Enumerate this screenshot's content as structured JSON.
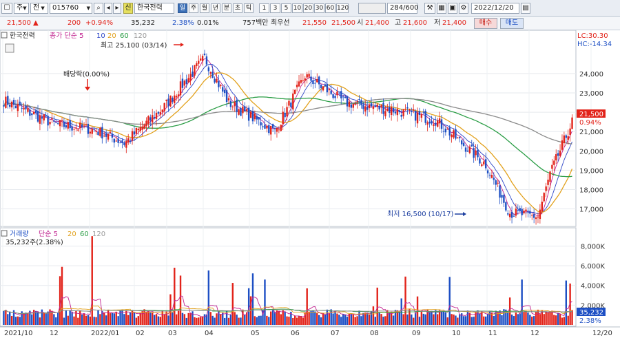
{
  "toolbar": {
    "market_select": "주",
    "type_select": "전",
    "code": "015760",
    "new_badge": "신",
    "stock_name": "한국전력",
    "periods": [
      "일",
      "주",
      "월",
      "년",
      "분",
      "초",
      "틱"
    ],
    "active_period": "일",
    "intervals": [
      "1",
      "3",
      "5",
      "10",
      "20",
      "30",
      "60",
      "120"
    ],
    "count": "284/600",
    "date": "2022/12/20"
  },
  "quote": {
    "price": "21,500",
    "arrow": "▲",
    "change": "200",
    "change_pct": "+0.94%",
    "volume": "35,232",
    "turnover_pct": "2.38%",
    "ratio": "0.01%",
    "amount": "757백만",
    "best_label": "최우선",
    "ask": "21,550",
    "bid": "21,500",
    "open_label": "시",
    "open": "21,400",
    "high_label": "고",
    "high": "21,600",
    "low_label": "저",
    "low": "21,400",
    "buy_btn": "매수",
    "sell_btn": "매도"
  },
  "price_panel": {
    "legend_name": "한국전력",
    "legend_ma_label": "종가 단순 5",
    "legend_periods": [
      "10",
      "20",
      "60",
      "120"
    ],
    "lc": "LC:30.30",
    "hc": "HC:-14.34",
    "annotation_high": "최고 25,100 (03/14)",
    "annotation_low": "최저 16,500 (10/17)",
    "annotation_div": "배당락(0.00%)",
    "current_price_tag": "21,500",
    "current_pct_tag": "0.94%",
    "y_ticks": [
      "24,000",
      "23,000",
      "22,000",
      "21,000",
      "20,000",
      "19,000",
      "18,000",
      "17,000"
    ]
  },
  "volume_panel": {
    "legend_name": "거래량",
    "legend_ma_label": "단순 5",
    "legend_periods": [
      "20",
      "60",
      "120"
    ],
    "sub_legend": "35,232주(2.38%)",
    "y_ticks": [
      "8,000K",
      "6,000K",
      "4,000K",
      "2,000K"
    ],
    "current_tag": "35,232",
    "current_pct_tag": "2.38%"
  },
  "x_axis": {
    "labels": [
      "2021/10",
      "12",
      "2022/01",
      "02",
      "03",
      "04",
      "05",
      "06",
      "07",
      "08",
      "09",
      "10",
      "11",
      "12",
      "12/20"
    ]
  },
  "colors": {
    "up": "#e2231a",
    "down": "#1d4fc4",
    "ma5": "#c0228f",
    "ma10": "#2f47c8",
    "ma20": "#e2a11c",
    "ma60": "#2a9d45",
    "ma120": "#8a8a8a"
  },
  "chart_data": {
    "type": "candlestick",
    "anchors": [
      {
        "date": "2021/10",
        "price": 22.6
      },
      {
        "date": "2021/11",
        "price": 21.4
      },
      {
        "date": "2021/12",
        "price": 21.1
      },
      {
        "date": "2022/01",
        "price": 20.4
      },
      {
        "date": "2022/02",
        "price": 22.3
      },
      {
        "date": "2022/03/14",
        "price": 25.1
      },
      {
        "date": "2022/04",
        "price": 22.5
      },
      {
        "date": "2022/05",
        "price": 21.0
      },
      {
        "date": "2022/05/20",
        "price": 23.9
      },
      {
        "date": "2022/06",
        "price": 22.5
      },
      {
        "date": "2022/07",
        "price": 22.1
      },
      {
        "date": "2022/08",
        "price": 21.6
      },
      {
        "date": "2022/09",
        "price": 19.3
      },
      {
        "date": "2022/10/17",
        "price": 16.5
      },
      {
        "date": "2022/11",
        "price": 18.6
      },
      {
        "date": "2022/12",
        "price": 20.5
      },
      {
        "date": "2022/12/20",
        "price": 21.5
      }
    ],
    "y_unit": "KRW thousands",
    "ylim": [
      16.2,
      25.6
    ],
    "volume_ylim": [
      0,
      9500
    ]
  }
}
